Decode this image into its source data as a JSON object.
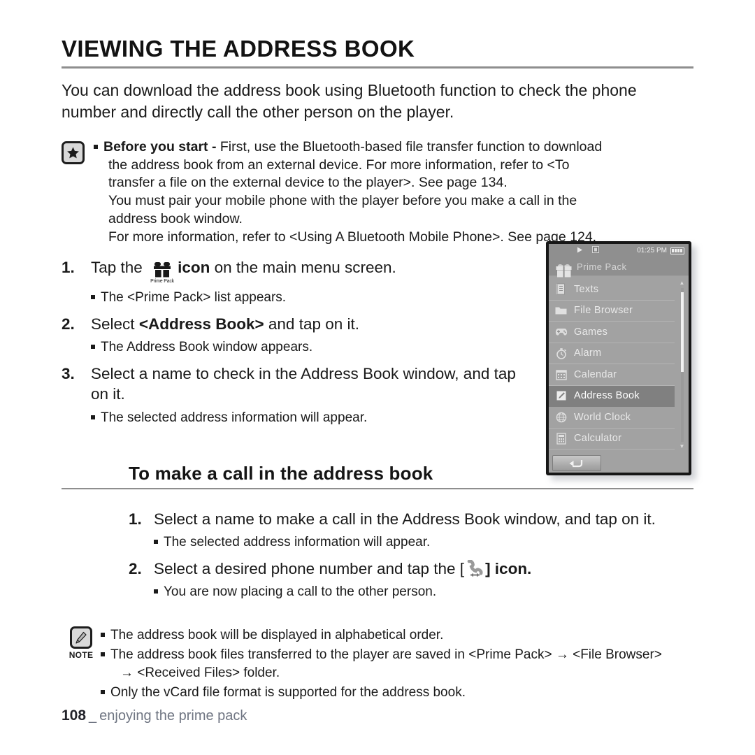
{
  "doc": {
    "title": "VIEWING THE ADDRESS BOOK",
    "intro": "You can download the address book using Bluetooth function to check the phone number and directly call the other person on the player."
  },
  "callout": {
    "icon": "star-icon",
    "label": "Before you start -",
    "line1": "First, use the Bluetooth-based file transfer function to download",
    "line2": "the address book from an external device. For more information, refer to <To",
    "line3": "transfer a file on the external device to the player>. See page 134.",
    "line4": "You must pair your mobile phone with the player before you make a call in the",
    "line5": "address book window.",
    "line6": "For more information, refer to <Using A Bluetooth Mobile Phone>. See page 124."
  },
  "steps": [
    {
      "num": "1.",
      "text_before": "Tap the",
      "icon_label": "Prime Pack",
      "text_after": "icon",
      "text_tail": "on the main menu screen.",
      "sub": "The <Prime Pack> list appears."
    },
    {
      "num": "2.",
      "text_before": "Select",
      "bold": "<Address Book>",
      "text_after": "and tap on it.",
      "sub": "The Address Book window appears."
    },
    {
      "num": "3.",
      "text_before": "Select a name to check in the Address Book window, and tap on it.",
      "sub": "The selected address information will appear."
    }
  ],
  "device": {
    "status": {
      "play_icon": "play-icon",
      "badge_icon": "status-badge-icon",
      "time": "01:25 PM",
      "battery_icon": "battery-icon"
    },
    "header_title": "Prime Pack",
    "header_icon": "gift-icon",
    "menu": [
      {
        "label": "Texts",
        "icon": "document-icon",
        "selected": false
      },
      {
        "label": "File Browser",
        "icon": "folder-icon",
        "selected": false
      },
      {
        "label": "Games",
        "icon": "gamepad-icon",
        "selected": false
      },
      {
        "label": "Alarm",
        "icon": "stopwatch-icon",
        "selected": false
      },
      {
        "label": "Calendar",
        "icon": "calendar-icon",
        "selected": false
      },
      {
        "label": "Address Book",
        "icon": "addressbook-icon",
        "selected": true
      },
      {
        "label": "World Clock",
        "icon": "globe-icon",
        "selected": false
      },
      {
        "label": "Calculator",
        "icon": "calculator-icon",
        "selected": false
      }
    ],
    "back_button_icon": "back-arrow-icon",
    "scroll_up_icon": "caret-up-icon",
    "scroll_down_icon": "caret-down-icon"
  },
  "section2": {
    "heading": "To make a call in the address book",
    "steps": [
      {
        "num": "1.",
        "text": "Select a name to make a call  in the Address Book window, and tap on it.",
        "sub": "The selected address information will appear."
      },
      {
        "num": "2.",
        "text_before": "Select a desired phone number and tap the [",
        "icon": "phone-call-icon",
        "text_after": "] icon.",
        "sub": "You are now placing a call to the other person."
      }
    ]
  },
  "note": {
    "icon": "note-pencil-icon",
    "label": "NOTE",
    "lines": [
      "The address book will be displayed in alphabetical order.",
      "The address book files  transferred to the player are saved in <Prime Pack> → <File Browser>",
      "Only the vCard file format is supported for the address book."
    ],
    "line2_cont": "→ <Received Files> folder."
  },
  "footer": {
    "page": "108",
    "separator": "_",
    "text": "enjoying the prime pack"
  }
}
